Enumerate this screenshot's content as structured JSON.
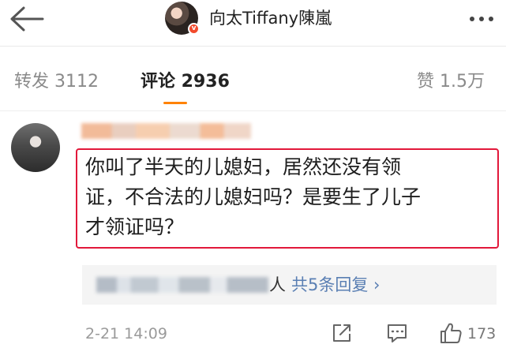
{
  "header": {
    "title": "向太Tiffany陳嵐",
    "back_icon": "arrow-left-icon",
    "more_icon": "more-dots-icon",
    "verified_badge": "v"
  },
  "stats": {
    "reposts_label": "转发 3112",
    "comments_label": "评论 2936",
    "likes_label": "赞 1.5万",
    "active_tab_color": "#ff8200"
  },
  "comment": {
    "text_lines": [
      "你叫了半天的儿媳妇，居然还没有领",
      "证，不合法的儿媳妇吗？是要生了儿子",
      "才领证吗？"
    ],
    "highlight_color": "#e2183a",
    "replies": {
      "suffix": "人",
      "count_label": "共5条回复 ›",
      "link_color": "#5a7fb3"
    },
    "timestamp": "2-21 14:09",
    "like_count": "173"
  }
}
